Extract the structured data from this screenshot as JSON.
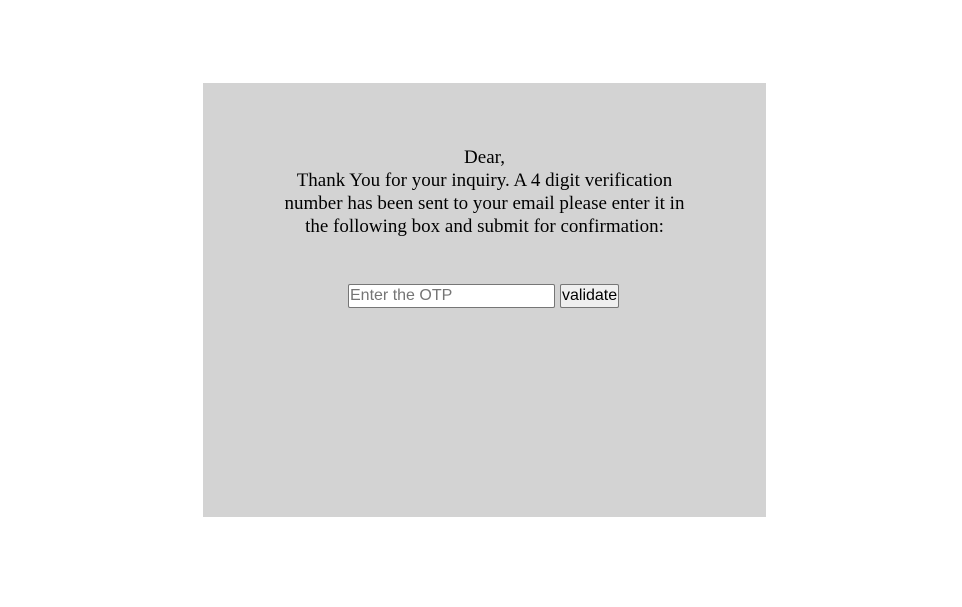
{
  "message": {
    "greeting": "Dear,",
    "body": "Thank You for your inquiry. A 4 digit verification number has been sent to your email please enter it in the following box and submit for confirmation:"
  },
  "otp_form": {
    "input_value": "",
    "input_placeholder": "Enter the OTP",
    "submit_label": "validate"
  },
  "colors": {
    "page_background": "#ffffff",
    "panel_background": "#d3d3d3"
  }
}
